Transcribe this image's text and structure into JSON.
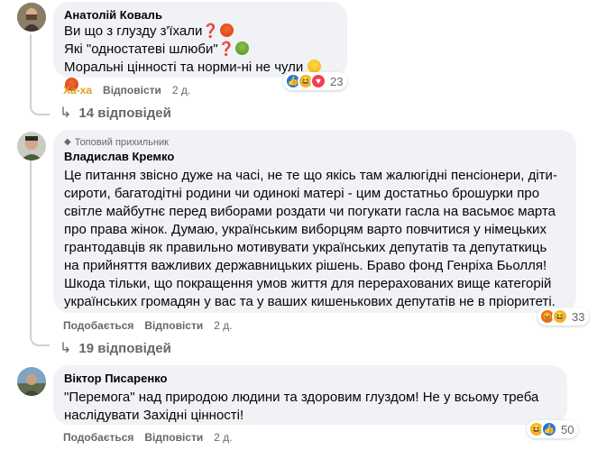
{
  "comments": [
    {
      "author": "Анатолій Коваль",
      "lines": [
        {
          "text": "Ви що з глузду з'їхали",
          "marks": "❓",
          "emoji": "angry"
        },
        {
          "text": "Які \"одностатеві шлюби\"",
          "marks": "❓",
          "emoji": "sick"
        },
        {
          "text": "Моральні цінності та норми-ні не чули",
          "marks": "",
          "emoji": "roll",
          "emoji2": "angry"
        }
      ],
      "actions": {
        "react": "Ха-ха",
        "reply": "Відповісти",
        "time": "2 д."
      },
      "reactions": {
        "icons": [
          "like-icon",
          "haha-icon",
          "love-icon"
        ],
        "count": "23"
      },
      "replies": "14 відповідей"
    },
    {
      "badge": "Топовий прихильник",
      "author": "Владислав Кремко",
      "text": "Це питання звісно дуже на часі, не те що якісь там жалюгідні пенсіонери, діти-сироти, багатодітні родини чи одинокі матері - цим достатньо брошурки про світле майбутнє перед виборами роздати чи погукати гасла на васьмоє марта про права жінок. Думаю, українським виборцям варто повчитися у німецьких грантодавців як правильно мотивувати українських депутатів та депутаткиць на прийняття важливих державницьких рішень. Браво фонд Генріха Бьолля! Шкода тільки, що покращення умов життя для перерахованих вище категорій українських громадян у вас та у ваших кишенькових депутатів не в пріоритеті.",
      "actions": {
        "react": "Подобається",
        "reply": "Відповісти",
        "time": "2 д."
      },
      "reactions": {
        "icons": [
          "angry-icon",
          "haha-icon"
        ],
        "count": "33"
      },
      "replies": "19 відповідей"
    },
    {
      "author": "Віктор Писаренко",
      "text": "\"Перемога\" над природою людини та здоровим глуздом! Не у всьому треба наслідувати Західні цінності!",
      "actions": {
        "react": "Подобається",
        "reply": "Відповісти",
        "time": "2 д."
      },
      "reactions": {
        "icons": [
          "haha-icon",
          "like-icon"
        ],
        "count": "50"
      }
    }
  ],
  "colors": {
    "bubble": "#f0f2f5",
    "meta": "#65676b",
    "text": "#050505",
    "haha_label": "#d8a21b"
  }
}
